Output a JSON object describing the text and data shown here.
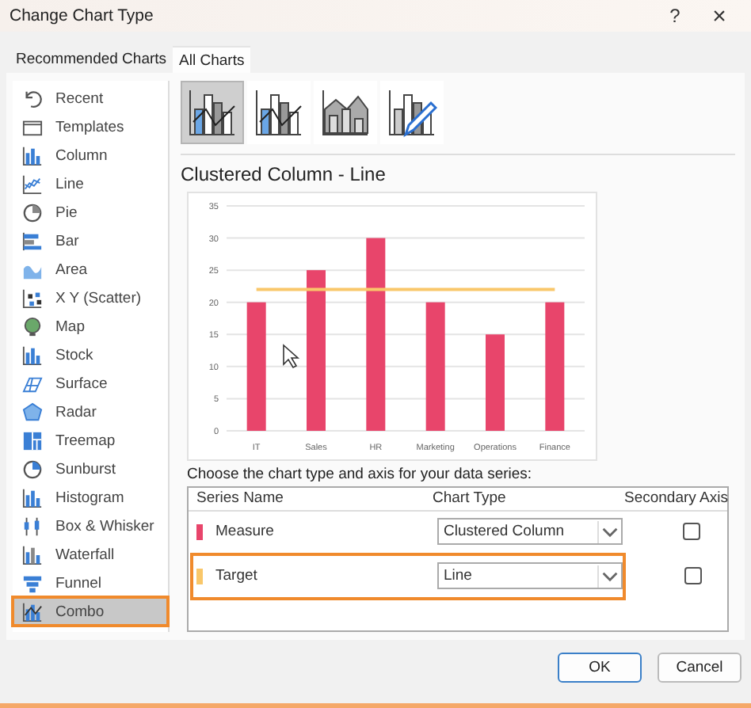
{
  "window": {
    "title": "Change Chart Type",
    "help": "?",
    "close": "×"
  },
  "tabs": [
    {
      "label": "Recommended Charts",
      "selected": false
    },
    {
      "label": "All Charts",
      "selected": true
    }
  ],
  "chart_types": [
    {
      "label": "Recent",
      "selected": false,
      "highlighted": false
    },
    {
      "label": "Templates",
      "selected": false,
      "highlighted": false
    },
    {
      "label": "Column",
      "selected": false,
      "highlighted": false
    },
    {
      "label": "Line",
      "selected": false,
      "highlighted": false
    },
    {
      "label": "Pie",
      "selected": false,
      "highlighted": false
    },
    {
      "label": "Bar",
      "selected": false,
      "highlighted": false
    },
    {
      "label": "Area",
      "selected": false,
      "highlighted": false
    },
    {
      "label": "X Y (Scatter)",
      "selected": false,
      "highlighted": false
    },
    {
      "label": "Map",
      "selected": false,
      "highlighted": false
    },
    {
      "label": "Stock",
      "selected": false,
      "highlighted": false
    },
    {
      "label": "Surface",
      "selected": false,
      "highlighted": false
    },
    {
      "label": "Radar",
      "selected": false,
      "highlighted": false
    },
    {
      "label": "Treemap",
      "selected": false,
      "highlighted": false
    },
    {
      "label": "Sunburst",
      "selected": false,
      "highlighted": false
    },
    {
      "label": "Histogram",
      "selected": false,
      "highlighted": false
    },
    {
      "label": "Box & Whisker",
      "selected": false,
      "highlighted": false
    },
    {
      "label": "Waterfall",
      "selected": false,
      "highlighted": false
    },
    {
      "label": "Funnel",
      "selected": false,
      "highlighted": false
    },
    {
      "label": "Combo",
      "selected": true,
      "highlighted": true
    }
  ],
  "subtypes": [
    {
      "selected": true
    },
    {
      "selected": false
    },
    {
      "selected": false
    },
    {
      "selected": false
    }
  ],
  "preview": {
    "title": "Clustered Column - Line",
    "chart_data": {
      "type": "bar",
      "categories": [
        "IT",
        "Sales",
        "HR",
        "Marketing",
        "Operations",
        "Finance"
      ],
      "ylim": [
        0,
        35
      ],
      "yticks": [
        0,
        5,
        10,
        15,
        20,
        25,
        30,
        35
      ],
      "grid": true,
      "series": [
        {
          "color": "#e8456b",
          "type": "bar",
          "values": [
            20,
            25,
            30,
            20,
            15,
            20
          ]
        },
        {
          "color": "#f9c76a",
          "type": "line",
          "values": [
            22,
            22,
            22,
            22,
            22,
            22
          ]
        }
      ]
    }
  },
  "series_prompt": "Choose the chart type and axis for your data series:",
  "series_table": {
    "columns": [
      "Series Name",
      "Chart Type",
      "Secondary Axis"
    ],
    "rows": [
      {
        "name": "Measure",
        "color": "#e8456b",
        "chart_type": "Clustered Column",
        "secondary_axis": false,
        "highlighted": false
      },
      {
        "name": "Target",
        "color": "#f9c76a",
        "chart_type": "Line",
        "secondary_axis": false,
        "highlighted": true
      }
    ]
  },
  "buttons": [
    {
      "label": "OK",
      "default": true
    },
    {
      "label": "Cancel",
      "default": false
    }
  ]
}
